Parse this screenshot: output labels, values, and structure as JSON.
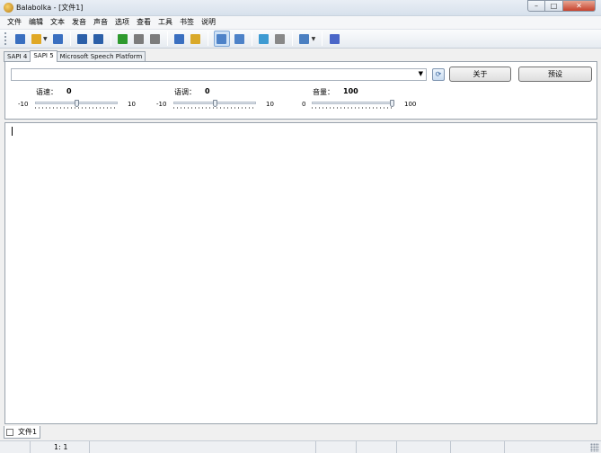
{
  "window": {
    "title": "Balabolka - [文件1]"
  },
  "menu": [
    "文件",
    "编辑",
    "文本",
    "发音",
    "声音",
    "选项",
    "查看",
    "工具",
    "书签",
    "说明"
  ],
  "toolbar": {
    "buttons": [
      {
        "name": "new-document",
        "color": "#3a6fc0"
      },
      {
        "name": "open-file",
        "color": "#e0a825"
      },
      {
        "name": "save-file",
        "color": "#3a6fc0"
      },
      {
        "name": "save-audio",
        "color": "#2b5fa8"
      },
      {
        "name": "save-audio-split",
        "color": "#2b5fa8"
      },
      {
        "name": "play",
        "color": "#2e9a2e"
      },
      {
        "name": "pause",
        "color": "#7c7c7c"
      },
      {
        "name": "stop",
        "color": "#7c7c7c"
      },
      {
        "name": "read-clipboard",
        "color": "#3a6fc0"
      },
      {
        "name": "read-selection",
        "color": "#d9a92a"
      },
      {
        "name": "text-view",
        "color": "#4d82c8"
      },
      {
        "name": "next-view",
        "color": "#4d82c8"
      },
      {
        "name": "copy-document",
        "color": "#3d9ad2"
      },
      {
        "name": "paste-document",
        "color": "#888888"
      },
      {
        "name": "speech-options",
        "color": "#4a7fc1"
      },
      {
        "name": "help",
        "color": "#4a66c8"
      }
    ]
  },
  "tabs": [
    {
      "label": "SAPI 4",
      "active": false
    },
    {
      "label": "SAPI 5",
      "active": true
    },
    {
      "label": "Microsoft Speech Platform",
      "active": false
    }
  ],
  "voice": {
    "selected": ""
  },
  "buttons": {
    "about": "关于",
    "preset": "预设"
  },
  "sliders": [
    {
      "label": "语速：",
      "value": "0",
      "min": "-10",
      "max": "10",
      "level": 0.5
    },
    {
      "label": "语调：",
      "value": "0",
      "min": "-10",
      "max": "10",
      "level": 0.5
    },
    {
      "label": "音量：",
      "value": "100",
      "min": "0",
      "max": "100",
      "level": 1.0
    }
  ],
  "documents": [
    {
      "label": "文件1"
    }
  ],
  "status": {
    "position": "1:  1"
  }
}
